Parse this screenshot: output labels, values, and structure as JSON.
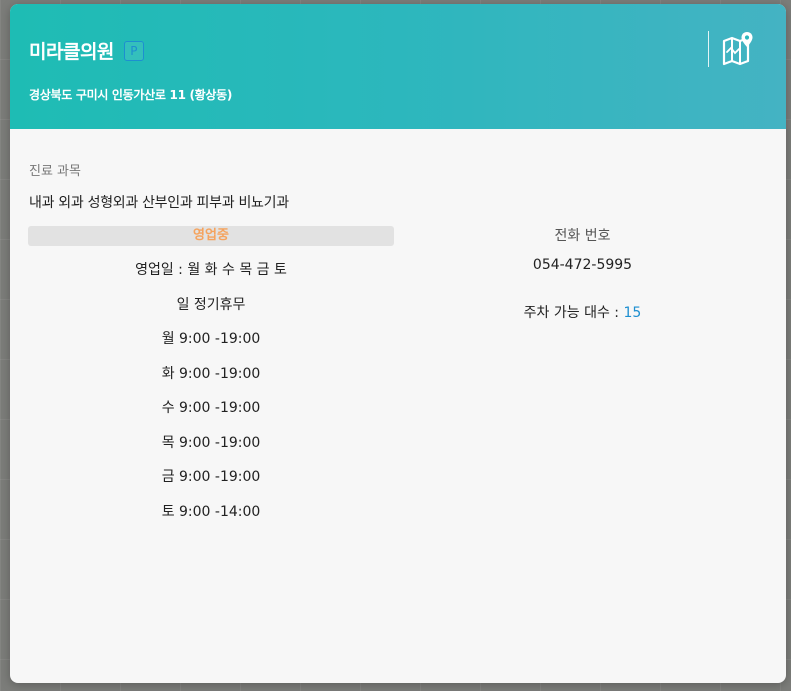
{
  "header": {
    "clinic_name": "미라클의원",
    "parking_badge": "P",
    "address": "경상북도 구미시 인동가산로 11 (황상동)",
    "map_icon": "map-pin-icon",
    "accent_color": "#1ebcb4"
  },
  "departments": {
    "label": "진료 과목",
    "list": "내과 외과 성형외과 산부인과 피부과 비뇨기과"
  },
  "status": {
    "label": "영업중",
    "color": "#f5a35e"
  },
  "hours": {
    "open_days": "영업일 : 월 화 수 목 금 토",
    "closed_days": "일 정기휴무",
    "schedule": [
      "월 9:00 -19:00",
      "화 9:00 -19:00",
      "수 9:00 -19:00",
      "목 9:00 -19:00",
      "금 9:00 -19:00",
      "토 9:00 -14:00"
    ]
  },
  "contact": {
    "phone_label": "전화 번호",
    "phone": "054-472-5995"
  },
  "parking": {
    "label": "주차 가능 대수 : ",
    "count": "15"
  }
}
